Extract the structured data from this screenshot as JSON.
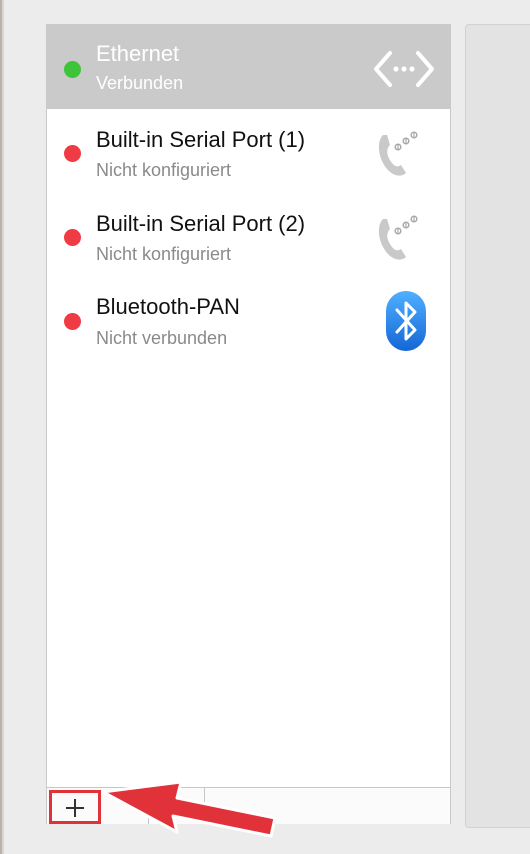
{
  "services": [
    {
      "name": "Ethernet",
      "status": "Verbunden",
      "status_color": "#3ec43a",
      "icon": "ethernet-icon",
      "selected": true
    },
    {
      "name": "Built-in Serial Port (1)",
      "status": "Nicht konfiguriert",
      "status_color": "#ef3b43",
      "icon": "phone-modem-icon",
      "selected": false
    },
    {
      "name": "Built-in Serial Port (2)",
      "status": "Nicht konfiguriert",
      "status_color": "#ef3b43",
      "icon": "phone-modem-icon",
      "selected": false
    },
    {
      "name": "Bluetooth-PAN",
      "status": "Nicht verbunden",
      "status_color": "#ef3b43",
      "icon": "bluetooth-icon",
      "selected": false
    }
  ],
  "toolbar": {
    "add_icon": "plus-icon",
    "remove_icon": "minus-icon",
    "action_icon": "gear-icon",
    "highlight_color": "#e1323a"
  },
  "colors": {
    "selection": "#cacaca",
    "connected": "#3ec43a",
    "disconnected": "#ef3b43",
    "bluetooth": "#1b84e6"
  }
}
